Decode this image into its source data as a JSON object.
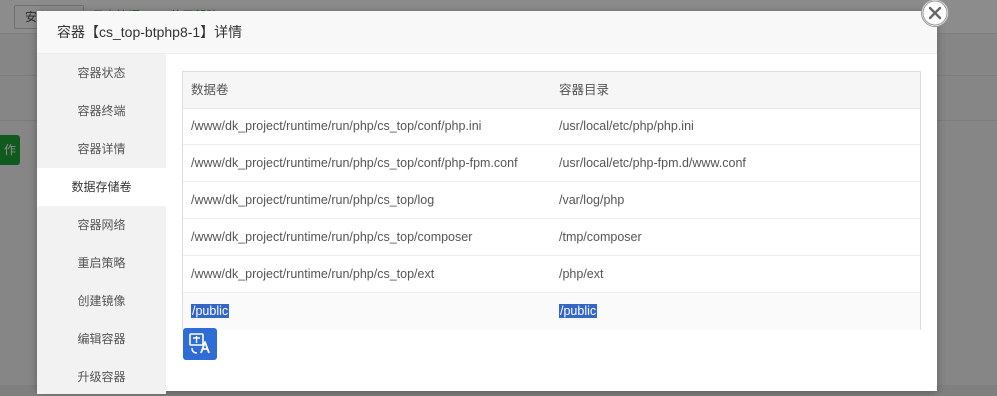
{
  "background": {
    "tabs": [
      "安全设置",
      "日志管理",
      "使用帮助"
    ],
    "green_button_label": "作"
  },
  "modal": {
    "title": "容器【cs_top-btphp8-1】详情"
  },
  "sidebar": {
    "items": [
      {
        "label": "容器状态"
      },
      {
        "label": "容器终端"
      },
      {
        "label": "容器详情"
      },
      {
        "label": "数据存储卷"
      },
      {
        "label": "容器网络"
      },
      {
        "label": "重启策略"
      },
      {
        "label": "创建镜像"
      },
      {
        "label": "编辑容器"
      },
      {
        "label": "升级容器"
      }
    ],
    "active_index": 3
  },
  "table": {
    "columns": [
      "数据卷",
      "容器目录"
    ],
    "rows": [
      [
        "/www/dk_project/runtime/run/php/cs_top/conf/php.ini",
        "/usr/local/etc/php/php.ini"
      ],
      [
        "/www/dk_project/runtime/run/php/cs_top/conf/php-fpm.conf",
        "/usr/local/etc/php-fpm.d/www.conf"
      ],
      [
        "/www/dk_project/runtime/run/php/cs_top/log",
        "/var/log/php"
      ],
      [
        "/www/dk_project/runtime/run/php/cs_top/composer",
        "/tmp/composer"
      ],
      [
        "/www/dk_project/runtime/run/php/cs_top/ext",
        "/php/ext"
      ],
      [
        "/public",
        "/public"
      ]
    ]
  },
  "icons": {
    "close": "close-icon",
    "translate": "translate-icon"
  },
  "colors": {
    "accent_green": "#20a53a",
    "selection_blue": "#3465c8",
    "translate_blue": "#2f6cd6"
  }
}
